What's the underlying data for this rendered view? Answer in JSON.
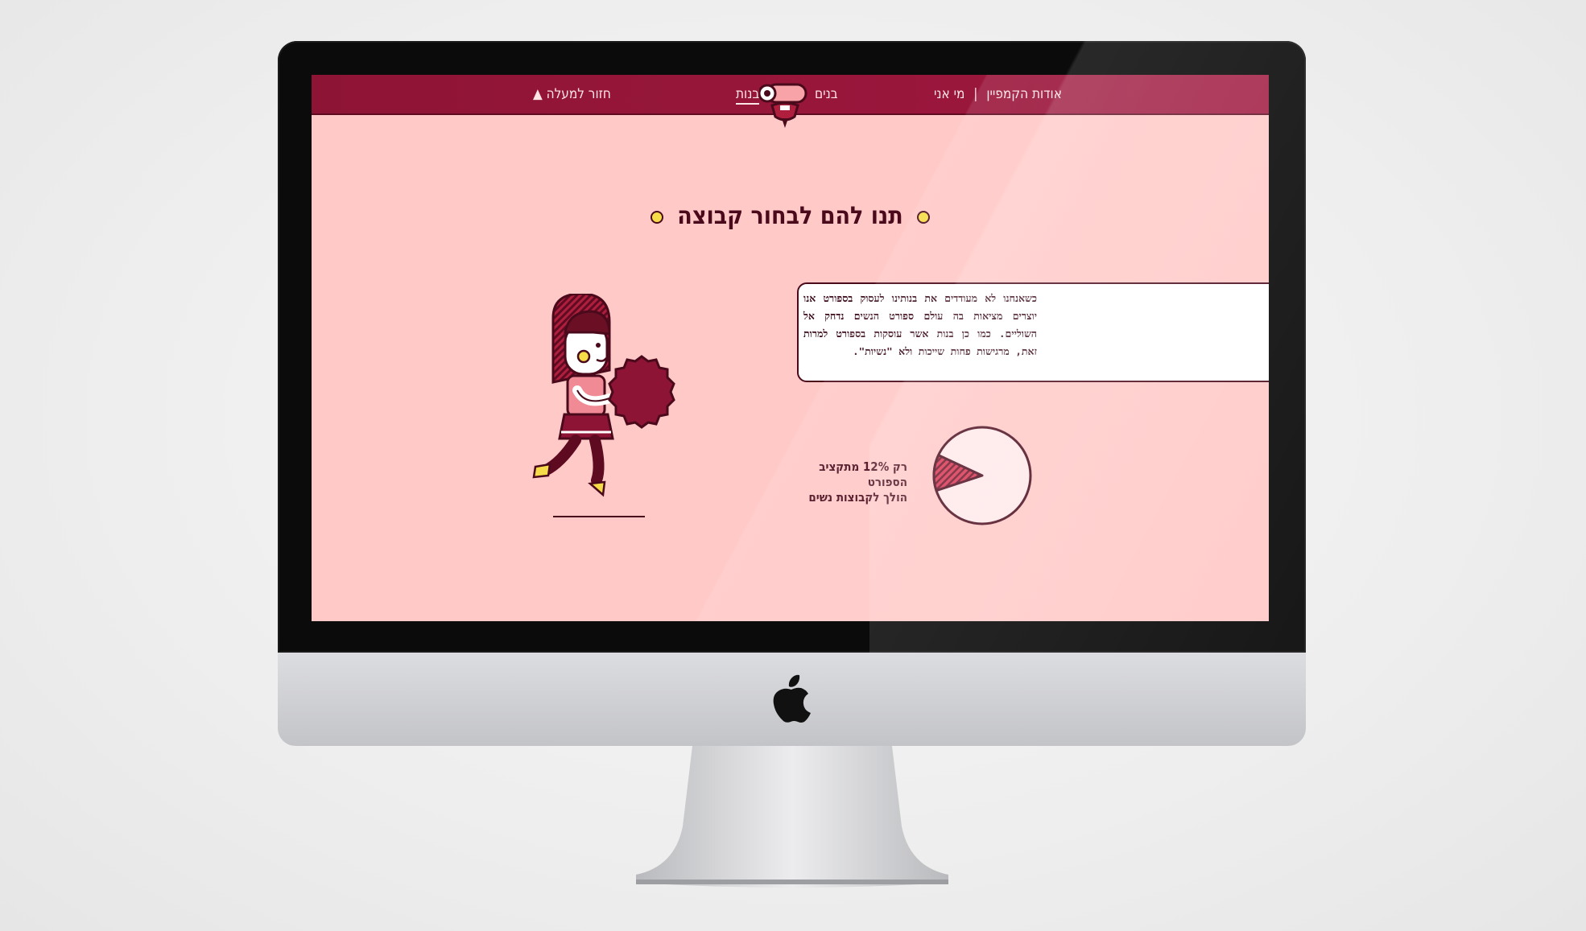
{
  "nav": {
    "about_label": "אודות הקמפיין",
    "separator": "|",
    "me_label": "מי אני",
    "boys_label": "בנים",
    "girls_label": "בנות",
    "back_to_top_label": "▲ חזור למעלה"
  },
  "headline": "תנו להם לבחור קבוצה",
  "info_text": "כשאנחנו לא מעודדים את בנותינו לעסוק בספורט אנו יוצרים מציאות בה עולם ספורט הנשים נדחק אל השוליים. כמו כן בנות אשר עוסקות בספורט למרות זאת, מרגישות פחות שייכות ולא \"נשיות\".",
  "stat": {
    "line1": "רק 12% מתקציב הספורט",
    "line2": "הולך לקבוצות נשים",
    "percent": 12
  },
  "colors": {
    "nav_bg": "#98163c",
    "page_bg": "#ffc9c7",
    "dark": "#4a0a1c",
    "accent_yellow": "#f5dc48",
    "pie_fill": "#ffe9ea",
    "pie_slice": "#d8304f"
  },
  "icons": {
    "mascot": "mascot-face-icon",
    "apple": "apple-logo-icon",
    "bullet": "yellow-dot-icon"
  }
}
